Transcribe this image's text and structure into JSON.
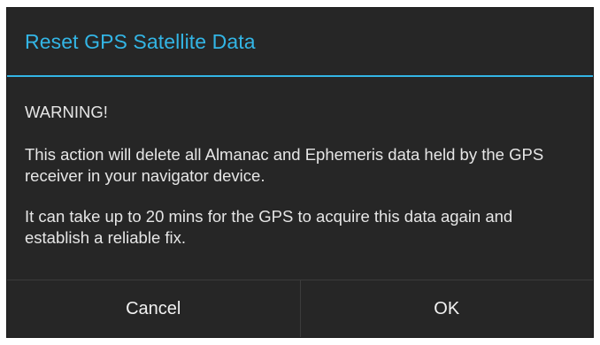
{
  "dialog": {
    "title": "Reset GPS Satellite Data",
    "warning": "WARNING!",
    "message_1": "This action will delete all Almanac and Ephemeris data held by the GPS receiver in your navigator device.",
    "message_2": "It can take up to 20 mins for the GPS to acquire this data again and establish a reliable fix.",
    "buttons": {
      "cancel": "Cancel",
      "ok": "OK"
    }
  },
  "colors": {
    "accent": "#33b5e5",
    "dialog_background": "#262626",
    "text": "#e6e6e6"
  }
}
